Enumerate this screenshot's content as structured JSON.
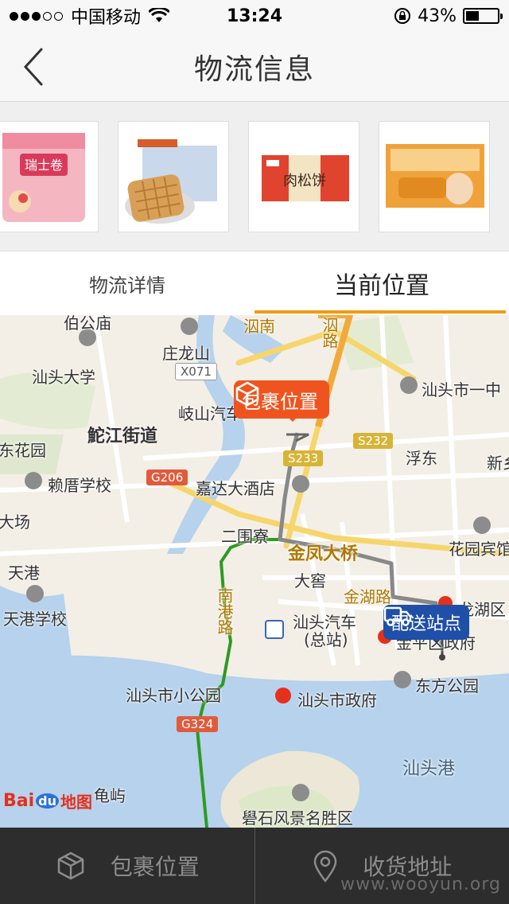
{
  "status_bar": {
    "carrier": "中国移动",
    "time": "13:24",
    "battery": "43%",
    "battery_level": 0.43,
    "signal_bars": 2
  },
  "nav": {
    "title": "物流信息",
    "back_icon": "chevron-left-icon"
  },
  "products": [
    {
      "name": "瑞士卷",
      "color": "#f39aa8"
    },
    {
      "name": "华夫饼",
      "color": "#e2b06a"
    },
    {
      "name": "肉松饼",
      "color": "#e0432e"
    },
    {
      "name": "法式软面包",
      "color": "#f0a23a"
    }
  ],
  "tabs": [
    {
      "label": "物流详情",
      "active": false
    },
    {
      "label": "当前位置",
      "active": true
    }
  ],
  "map": {
    "package_bubble": "包裹位置",
    "station_bubble": "配送站点",
    "labels": [
      {
        "text": "伯公庙"
      },
      {
        "text": "庄龙山"
      },
      {
        "text": "汕头大学"
      },
      {
        "text": "鮀江街道"
      },
      {
        "text": "岐山汽车"
      },
      {
        "text": "嘉达大酒店"
      },
      {
        "text": "赖厝学校"
      },
      {
        "text": "东花园"
      },
      {
        "text": "大场"
      },
      {
        "text": "天港"
      },
      {
        "text": "天港学校"
      },
      {
        "text": "二围寮"
      },
      {
        "text": "金凤大桥"
      },
      {
        "text": "大窖"
      },
      {
        "text": "金湖路"
      },
      {
        "text": "汕头汽车"
      },
      {
        "text": "(总站)"
      },
      {
        "text": "汕头市小公园"
      },
      {
        "text": "汕头市政府"
      },
      {
        "text": "东方公园"
      },
      {
        "text": "汕头港"
      },
      {
        "text": "龟屿"
      },
      {
        "text": "礐石风景名胜区"
      },
      {
        "text": "汕头市一中"
      },
      {
        "text": "浮东"
      },
      {
        "text": "新乡"
      },
      {
        "text": "花园宾馆"
      },
      {
        "text": "龙湖区"
      },
      {
        "text": "金平区政府"
      },
      {
        "text": "南港路"
      },
      {
        "text": "泅南"
      },
      {
        "text": "泅路"
      }
    ],
    "badges": [
      {
        "text": "X071"
      },
      {
        "text": "G206"
      },
      {
        "text": "S232"
      },
      {
        "text": "S233"
      },
      {
        "text": "G324"
      }
    ],
    "logo": {
      "bai": "Bai",
      "du": "du",
      "map": "地图"
    }
  },
  "bottom_bar": {
    "package_location": "包裹位置",
    "delivery_address": "收货地址",
    "watermark": "www.wooyun.org"
  },
  "colors": {
    "accent": "#f39a12",
    "package_bubble": "#f0541e",
    "station_bubble": "#1f4fa8",
    "route_green": "#2f9a1f",
    "route_grey": "#888888",
    "sea": "#b6d2ec"
  }
}
